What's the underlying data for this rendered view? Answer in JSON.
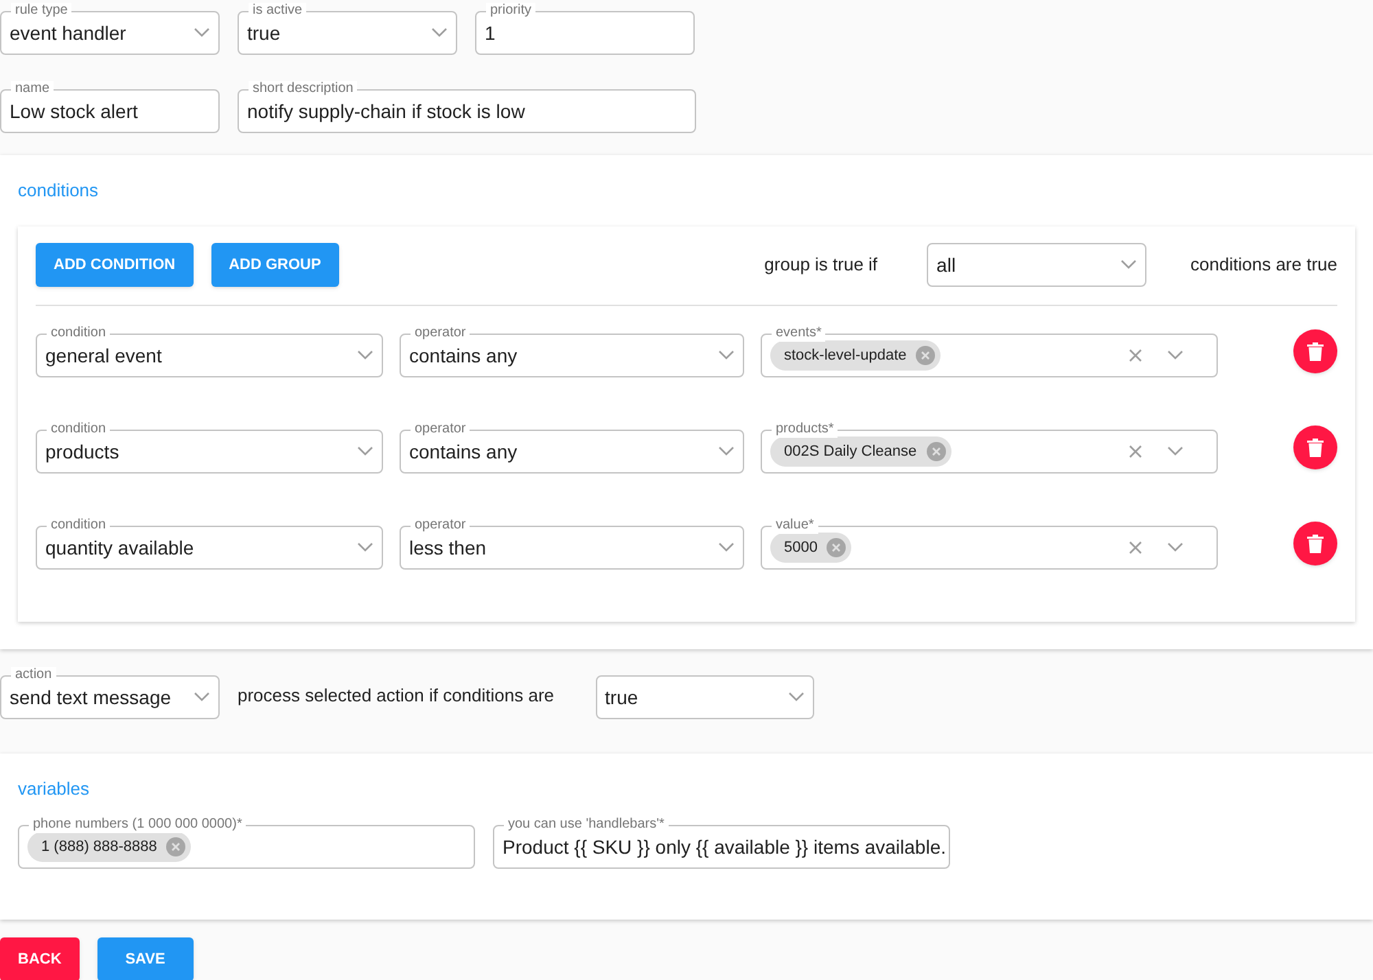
{
  "rule_fields": [
    {
      "kind": "select",
      "label": "rule type",
      "value": "event handler"
    },
    {
      "kind": "select",
      "label": "is active",
      "value": "true"
    },
    {
      "kind": "text",
      "label": "priority",
      "value": "1"
    }
  ],
  "info_fields": [
    {
      "kind": "text",
      "label": "name",
      "value": "Low stock alert"
    },
    {
      "kind": "text",
      "label": "short description",
      "value": "notify supply-chain if stock is low"
    }
  ],
  "conditions": {
    "title": "conditions",
    "buttons": [
      "ADD CONDITION",
      "ADD GROUP"
    ],
    "group_prefix": "group is true if",
    "group_select": {
      "value": "all"
    },
    "group_suffix": "conditions are true",
    "rows": [
      {
        "condition": {
          "label": "condition",
          "value": "general event"
        },
        "operator": {
          "label": "operator",
          "value": "contains any"
        },
        "target": {
          "label": "events*",
          "chips": [
            "stock-level-update"
          ]
        }
      },
      {
        "condition": {
          "label": "condition",
          "value": "products"
        },
        "operator": {
          "label": "operator",
          "value": "contains any"
        },
        "target": {
          "label": "products*",
          "chips": [
            "002S Daily Cleanse"
          ]
        }
      },
      {
        "condition": {
          "label": "condition",
          "value": "quantity available"
        },
        "operator": {
          "label": "operator",
          "value": "less then"
        },
        "target": {
          "label": "value*",
          "chips": [
            "5000"
          ]
        }
      }
    ]
  },
  "action": {
    "select": {
      "label": "action",
      "value": "send text message"
    },
    "text": "process selected action if conditions are",
    "when": {
      "value": "true"
    }
  },
  "variables": {
    "title": "variables",
    "phone": {
      "label": "phone numbers (1 000 000 0000)*",
      "chips": [
        "1 (888) 888-8888"
      ]
    },
    "message": {
      "label": "you can use 'handlebars'*",
      "value": "Product {{ SKU }} only {{ available }} items available."
    }
  },
  "footer_buttons": [
    {
      "kind": "danger",
      "label": "BACK"
    },
    {
      "kind": "primary",
      "label": "SAVE"
    }
  ]
}
